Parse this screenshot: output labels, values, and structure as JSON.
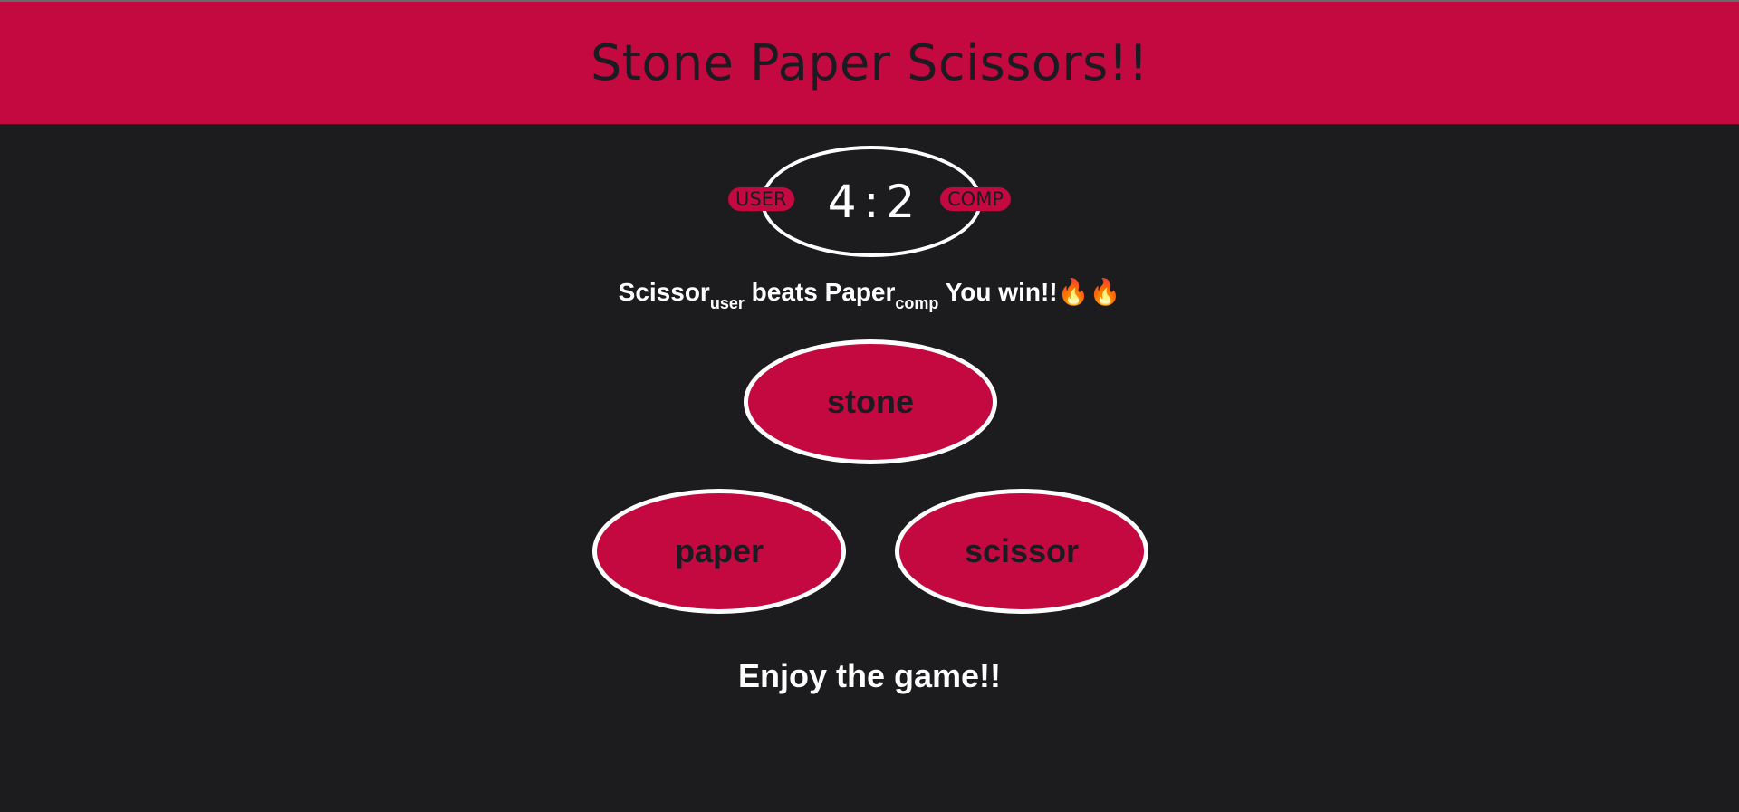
{
  "header": {
    "title": "Stone Paper Scissors!!"
  },
  "scoreboard": {
    "user_label": "USER",
    "comp_label": "COMP",
    "user_score": "4",
    "separator": ":",
    "comp_score": "2"
  },
  "message": {
    "user_choice": "Scissor",
    "user_sub": "user",
    "verb": "beats",
    "comp_choice": "Paper",
    "comp_sub": "comp",
    "result": "You win!!",
    "emoji": "🔥🔥"
  },
  "choices": {
    "stone": "stone",
    "paper": "paper",
    "scissor": "scissor"
  },
  "footer": {
    "text": "Enjoy the game!!"
  },
  "colors": {
    "accent": "#c3093f",
    "background": "#1c1c1e",
    "text_dark": "#1c1b22",
    "text_light": "#ffffff"
  }
}
